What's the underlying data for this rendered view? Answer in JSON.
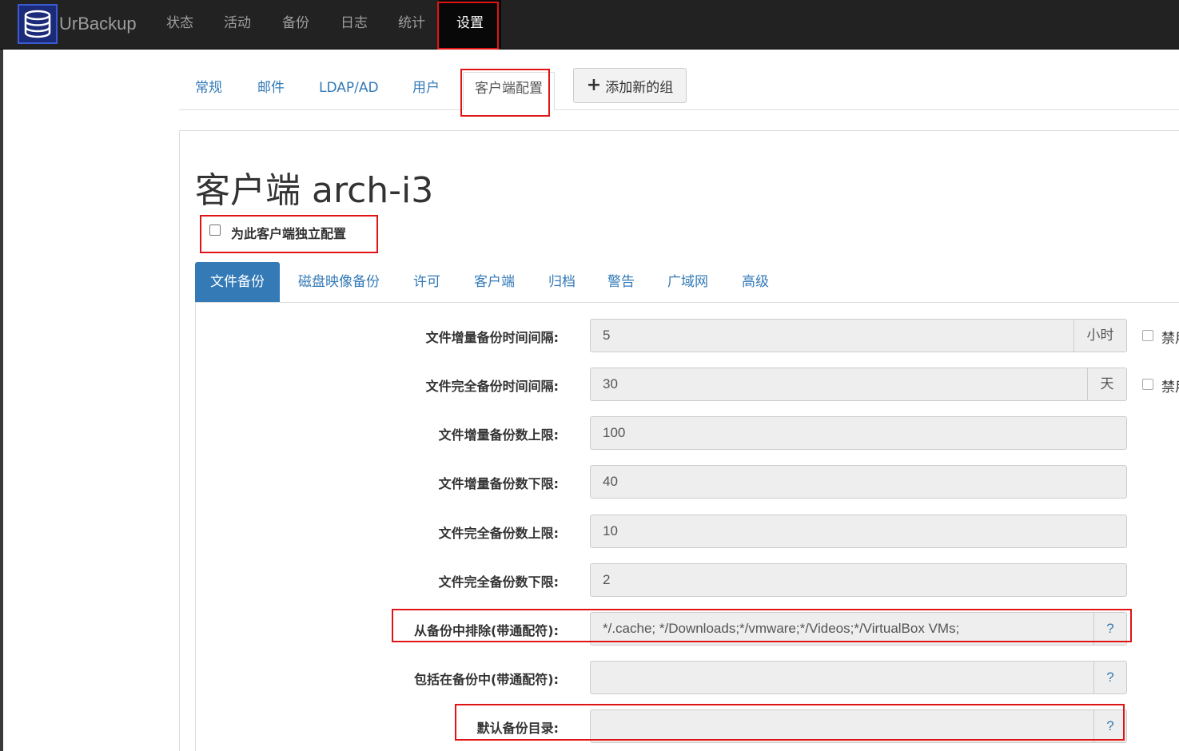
{
  "navbar": {
    "brand": "UrBackup",
    "items": [
      "状态",
      "活动",
      "备份",
      "日志",
      "统计",
      "设置"
    ],
    "active": "设置"
  },
  "settings_tabs": {
    "items": [
      "常规",
      "邮件",
      "LDAP/AD",
      "用户",
      "客户端配置"
    ],
    "active": "客户端配置",
    "add_group": "添加新的组"
  },
  "client": {
    "title": "客户端 arch-i3",
    "independent_config_label": "为此客户端独立配置",
    "independent_config_checked": false
  },
  "client_tabs": {
    "items": [
      "文件备份",
      "磁盘映像备份",
      "许可",
      "客户端",
      "归档",
      "警告",
      "广域网",
      "高级"
    ],
    "active": "文件备份"
  },
  "form": {
    "rows": [
      {
        "label": "文件增量备份时间间隔:",
        "value": "5",
        "unit": "小时",
        "side": "禁用"
      },
      {
        "label": "文件完全备份时间间隔:",
        "value": "30",
        "unit": "天",
        "side": "禁用"
      },
      {
        "label": "文件增量备份数上限:",
        "value": "100"
      },
      {
        "label": "文件增量备份数下限:",
        "value": "40"
      },
      {
        "label": "文件完全备份数上限:",
        "value": "10"
      },
      {
        "label": "文件完全备份数下限:",
        "value": "2"
      },
      {
        "label": "从备份中排除(带通配符):",
        "value": "*/.cache; */Downloads;*/vmware;*/Videos;*/VirtualBox VMs;",
        "help": "?"
      },
      {
        "label": "包括在备份中(带通配符):",
        "value": "",
        "help": "?"
      },
      {
        "label": "默认备份目录:",
        "value": "",
        "help": "?"
      }
    ]
  },
  "colors": {
    "navbar": "#222222",
    "link": "#337ab7",
    "highlight": "#e01414"
  }
}
